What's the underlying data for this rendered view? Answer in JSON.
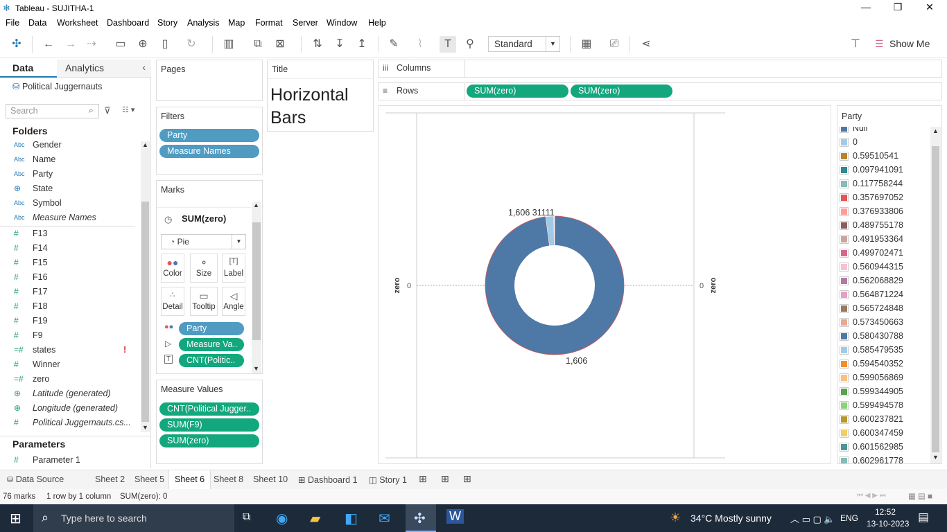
{
  "window": {
    "title": "Tableau - SUJITHA-1"
  },
  "menu": [
    "File",
    "Data",
    "Worksheet",
    "Dashboard",
    "Story",
    "Analysis",
    "Map",
    "Format",
    "Server",
    "Window",
    "Help"
  ],
  "toolbar": {
    "fit_select": "Standard",
    "show_me_label": "Show Me"
  },
  "data_pane": {
    "tab_data": "Data",
    "tab_analytics": "Analytics",
    "datasource": "Political Juggernauts",
    "search_placeholder": "Search",
    "folders_header": "Folders",
    "fields": [
      {
        "icon": "Abc",
        "name": "Gender"
      },
      {
        "icon": "Abc",
        "name": "Name"
      },
      {
        "icon": "Abc",
        "name": "Party"
      },
      {
        "icon": "globe-icon",
        "name": "State"
      },
      {
        "icon": "Abc",
        "name": "Symbol"
      },
      {
        "icon": "Abc",
        "name": "Measure Names"
      },
      {
        "icon": "#",
        "name": "F13"
      },
      {
        "icon": "#",
        "name": "F14"
      },
      {
        "icon": "#",
        "name": "F15"
      },
      {
        "icon": "#",
        "name": "F16"
      },
      {
        "icon": "#",
        "name": "F17"
      },
      {
        "icon": "#",
        "name": "F18"
      },
      {
        "icon": "#",
        "name": "F19"
      },
      {
        "icon": "#",
        "name": "F9"
      },
      {
        "icon": "=#",
        "name": "states",
        "flag": "!"
      },
      {
        "icon": "#",
        "name": "Winner"
      },
      {
        "icon": "=#",
        "name": "zero"
      },
      {
        "icon": "globe-icon",
        "name": "Latitude (generated)"
      },
      {
        "icon": "globe-icon",
        "name": "Longitude (generated)"
      },
      {
        "icon": "#",
        "name": "Political Juggernauts.cs..."
      }
    ],
    "parameters_header": "Parameters",
    "parameters": [
      {
        "icon": "#",
        "name": "Parameter 1"
      }
    ]
  },
  "shelves": {
    "pages": "Pages",
    "filters": "Filters",
    "filter_pills": [
      "Party",
      "Measure Names"
    ],
    "marks": "Marks",
    "marks_measure": "SUM(zero)",
    "mark_type": "Pie",
    "mark_buttons": [
      "Color",
      "Size",
      "Label",
      "Detail",
      "Tooltip",
      "Angle"
    ],
    "mark_pills": [
      "Party",
      "Measure Va..",
      "CNT(Politic.."
    ],
    "measure_values": "Measure Values",
    "measure_value_pills": [
      "CNT(Political Jugger..",
      "SUM(F9)",
      "SUM(zero)"
    ],
    "title_card": "Title",
    "title_text": "Horizontal Bars",
    "columns": "Columns",
    "rows": "Rows",
    "row_pills": [
      "SUM(zero)",
      "SUM(zero)"
    ]
  },
  "chart_data": {
    "type": "pie",
    "subtype": "donut",
    "axes": {
      "left_label": "zero",
      "left_tick": "0",
      "right_label": "zero",
      "right_tick": "0"
    },
    "slices": [
      {
        "label": "1,606",
        "value": 1606,
        "color": "#4e79a7"
      },
      {
        "label": "31",
        "value": 31,
        "color": "#a0cbe8"
      },
      {
        "label": "1",
        "value": 1,
        "color": "#a0cbe8"
      },
      {
        "label": "1",
        "value": 1,
        "color": "#e15759"
      },
      {
        "label": "1",
        "value": 1,
        "color": "#f28e2b"
      }
    ],
    "top_labels": "1,606  31111",
    "bottom_label": "1,606"
  },
  "legend": {
    "title": "Party",
    "items": [
      {
        "label": "Null",
        "color": "#4e79a7"
      },
      {
        "label": "0",
        "color": "#a0cbe8"
      },
      {
        "label": "0.59510541",
        "color": "#b6862c"
      },
      {
        "label": "0.097941091",
        "color": "#2e8b8b"
      },
      {
        "label": "0.117758244",
        "color": "#86bcb6"
      },
      {
        "label": "0.357697052",
        "color": "#e15759"
      },
      {
        "label": "0.376933806",
        "color": "#ff9d9a"
      },
      {
        "label": "0.489755178",
        "color": "#8c5d5d"
      },
      {
        "label": "0.491953364",
        "color": "#c7a6a0"
      },
      {
        "label": "0.499702471",
        "color": "#d4688c"
      },
      {
        "label": "0.560944315",
        "color": "#fabfd2"
      },
      {
        "label": "0.562068829",
        "color": "#b07aa1"
      },
      {
        "label": "0.564871224",
        "color": "#e3a0c6"
      },
      {
        "label": "0.565724848",
        "color": "#9d7660"
      },
      {
        "label": "0.573450663",
        "color": "#e6a996"
      },
      {
        "label": "0.580430788",
        "color": "#4e79a7"
      },
      {
        "label": "0.585479535",
        "color": "#a0cbe8"
      },
      {
        "label": "0.594540352",
        "color": "#f28e2b"
      },
      {
        "label": "0.599056869",
        "color": "#ffbe7d"
      },
      {
        "label": "0.599344905",
        "color": "#59a14f"
      },
      {
        "label": "0.599494578",
        "color": "#8cd17d"
      },
      {
        "label": "0.600237821",
        "color": "#b6992d"
      },
      {
        "label": "0.600347459",
        "color": "#f1ce63"
      },
      {
        "label": "0.601562985",
        "color": "#499894"
      },
      {
        "label": "0.602961778",
        "color": "#86bcb6"
      }
    ]
  },
  "sheet_tabs": [
    "Data Source",
    "Sheet 2",
    "Sheet 5",
    "Sheet 6",
    "Sheet 8",
    "Sheet 10",
    "Dashboard 1",
    "Story 1"
  ],
  "active_tab": "Sheet 6",
  "status": {
    "marks": "76 marks",
    "rows": "1 row by 1 column",
    "sum": "SUM(zero): 0"
  },
  "taskbar": {
    "search_placeholder": "Type here to search",
    "weather": "34°C  Mostly sunny",
    "lang": "ENG",
    "time": "12:52",
    "date": "13-10-2023"
  }
}
